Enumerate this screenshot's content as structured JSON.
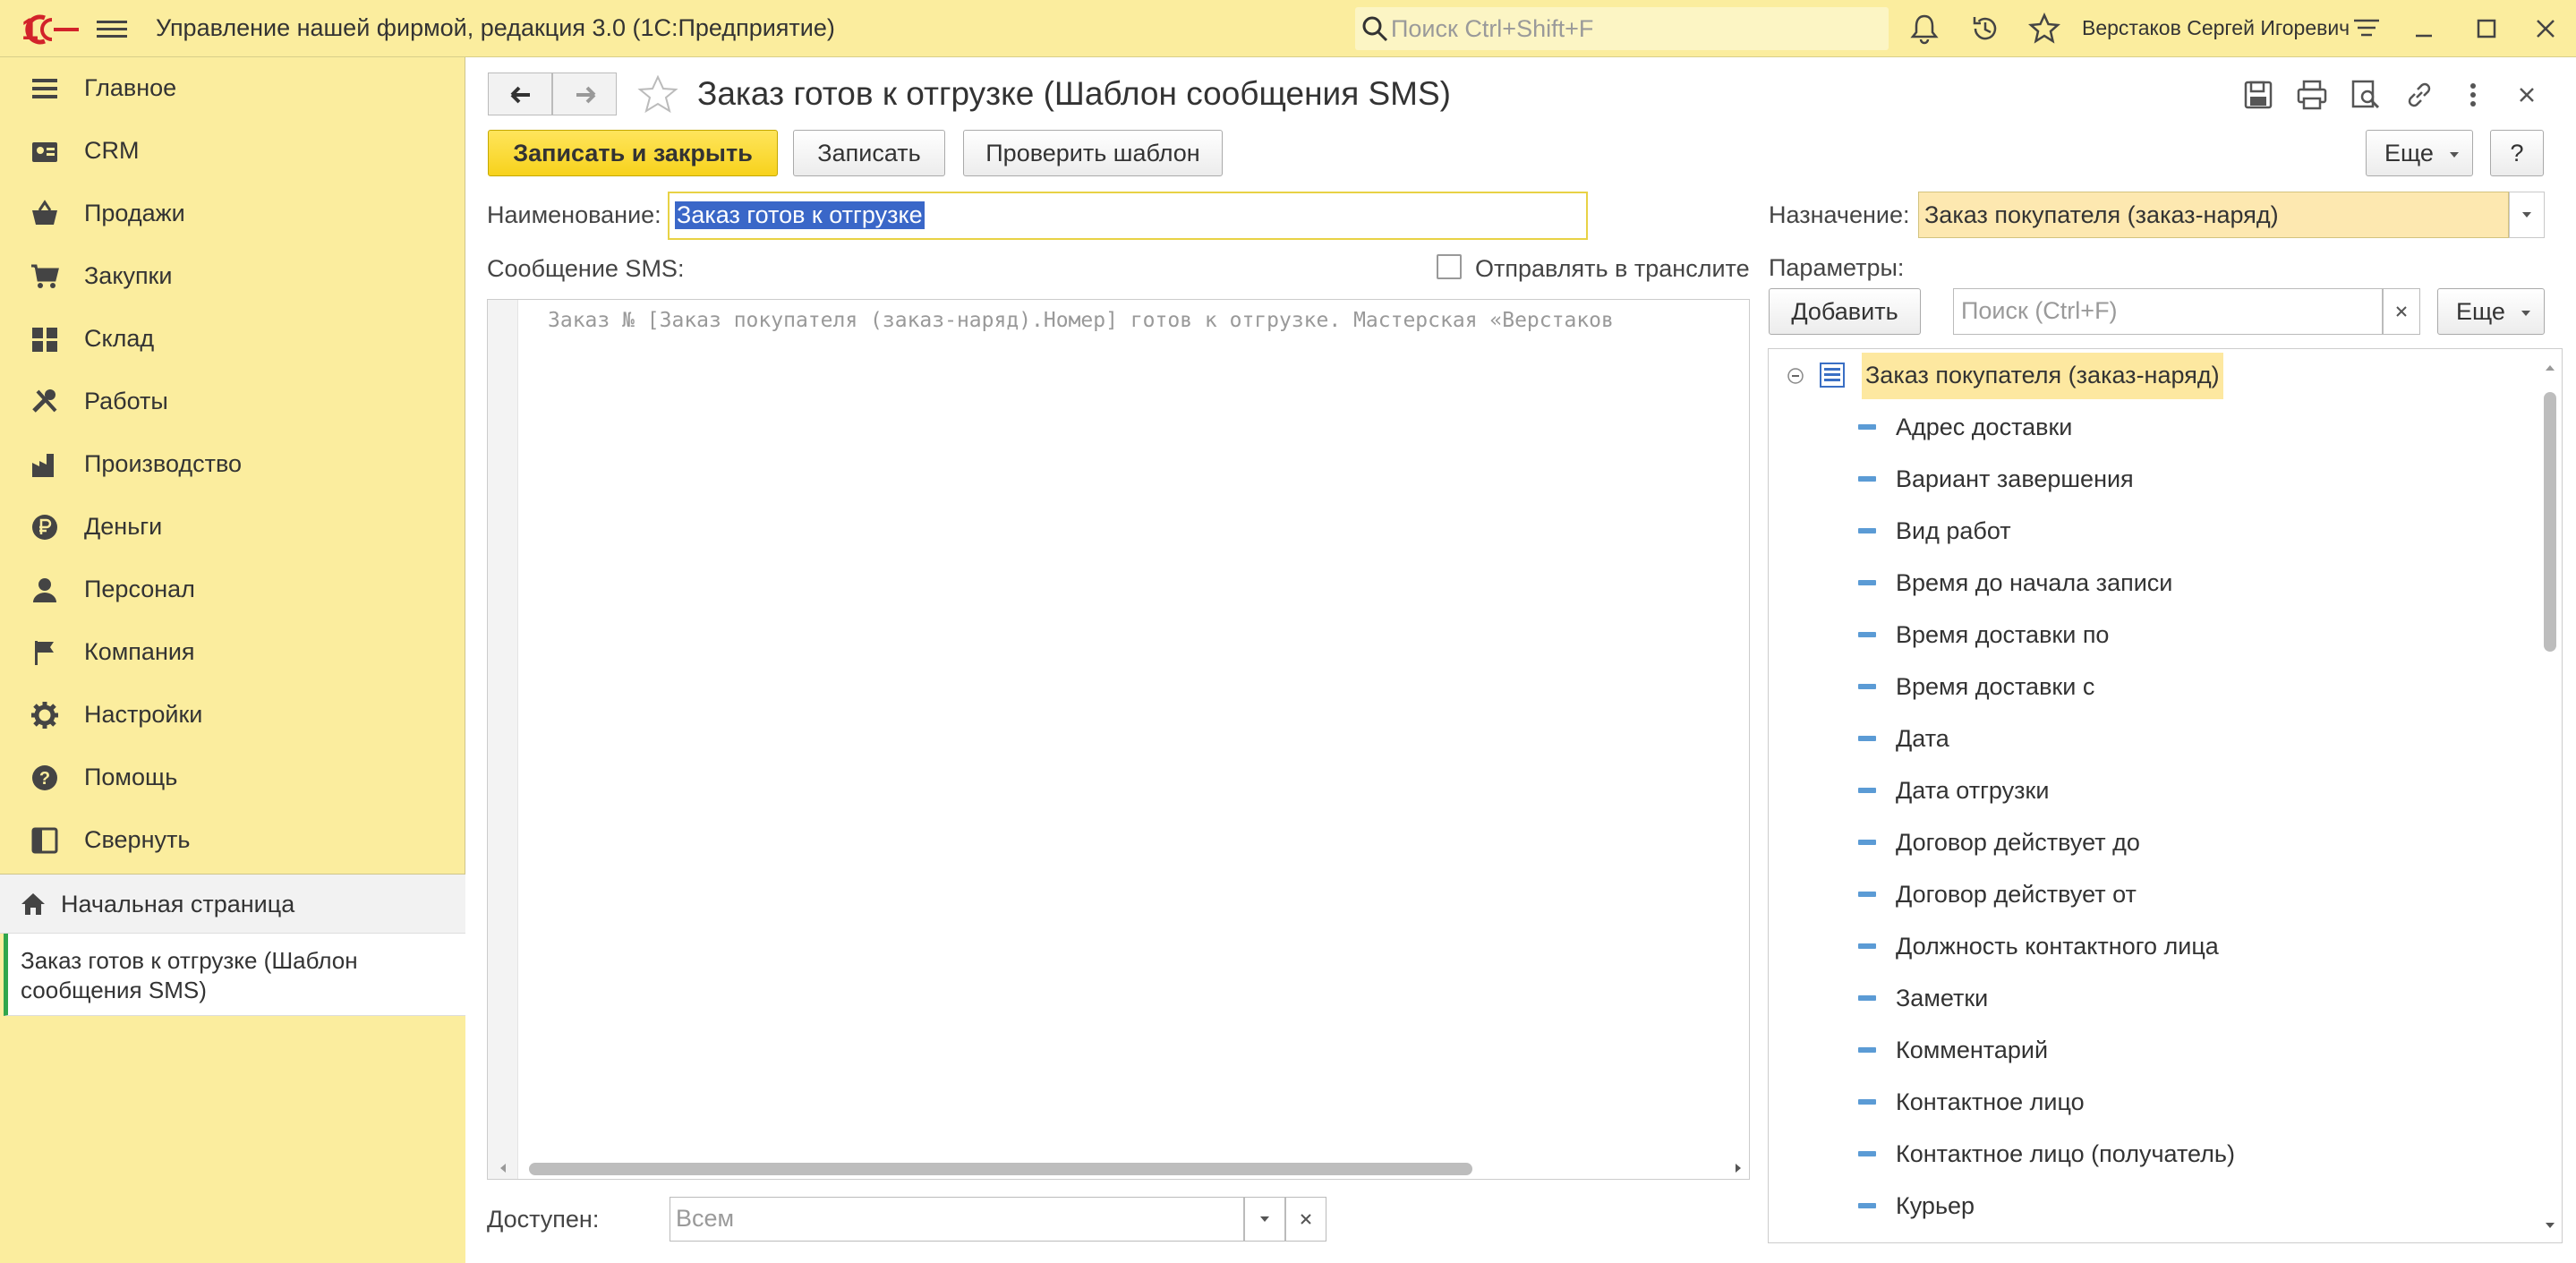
{
  "app": {
    "title": "Управление нашей фирмой, редакция 3.0  (1С:Предприятие)",
    "search_placeholder": "Поиск Ctrl+Shift+F",
    "user": "Верстаков Сергей Игоревич",
    "accent": "#fbed9e"
  },
  "sidebar": {
    "items": [
      {
        "label": "Главное",
        "icon": "menu-lines-icon"
      },
      {
        "label": "CRM",
        "icon": "contacts-card-icon"
      },
      {
        "label": "Продажи",
        "icon": "basket-icon"
      },
      {
        "label": "Закупки",
        "icon": "cart-icon"
      },
      {
        "label": "Склад",
        "icon": "warehouse-icon"
      },
      {
        "label": "Работы",
        "icon": "tools-icon"
      },
      {
        "label": "Производство",
        "icon": "factory-icon"
      },
      {
        "label": "Деньги",
        "icon": "ruble-icon"
      },
      {
        "label": "Персонал",
        "icon": "person-icon"
      },
      {
        "label": "Компания",
        "icon": "flag-icon"
      },
      {
        "label": "Настройки",
        "icon": "gear-icon"
      },
      {
        "label": "Помощь",
        "icon": "help-icon"
      },
      {
        "label": "Свернуть",
        "icon": "collapse-panel-icon"
      }
    ],
    "home": "Начальная страница",
    "open_window": "Заказ готов к отгрузке (Шаблон сообщения SMS)"
  },
  "form": {
    "title": "Заказ готов к отгрузке (Шаблон сообщения SMS)",
    "buttons": {
      "save_close": "Записать и закрыть",
      "save": "Записать",
      "check": "Проверить шаблон",
      "more": "Еще",
      "help": "?"
    },
    "name_label": "Наименование:",
    "name_value": "Заказ готов к отгрузке",
    "sms_label": "Сообщение SMS:",
    "translit_label": "Отправлять в транслите",
    "message_text": "Заказ № [Заказ покупателя (заказ-наряд).Номер] готов к отгрузке. Мастерская «Верстаков",
    "available_label": "Доступен:",
    "available_placeholder": "Всем",
    "purpose_label": "Назначение:",
    "purpose_value": "Заказ покупателя (заказ-наряд)",
    "params_label": "Параметры:",
    "add_button": "Добавить",
    "params_search_placeholder": "Поиск (Ctrl+F)",
    "params_more": "Еще",
    "tree_root": "Заказ покупателя (заказ-наряд)",
    "tree_items": [
      "Адрес доставки",
      "Вариант завершения",
      "Вид работ",
      "Время до начала записи",
      "Время доставки по",
      "Время доставки с",
      "Дата",
      "Дата отгрузки",
      "Договор действует до",
      "Договор действует от",
      "Должность контактного лица",
      "Заметки",
      "Комментарий",
      "Контактное лицо",
      "Контактное лицо (получатель)",
      "Курьер"
    ]
  }
}
